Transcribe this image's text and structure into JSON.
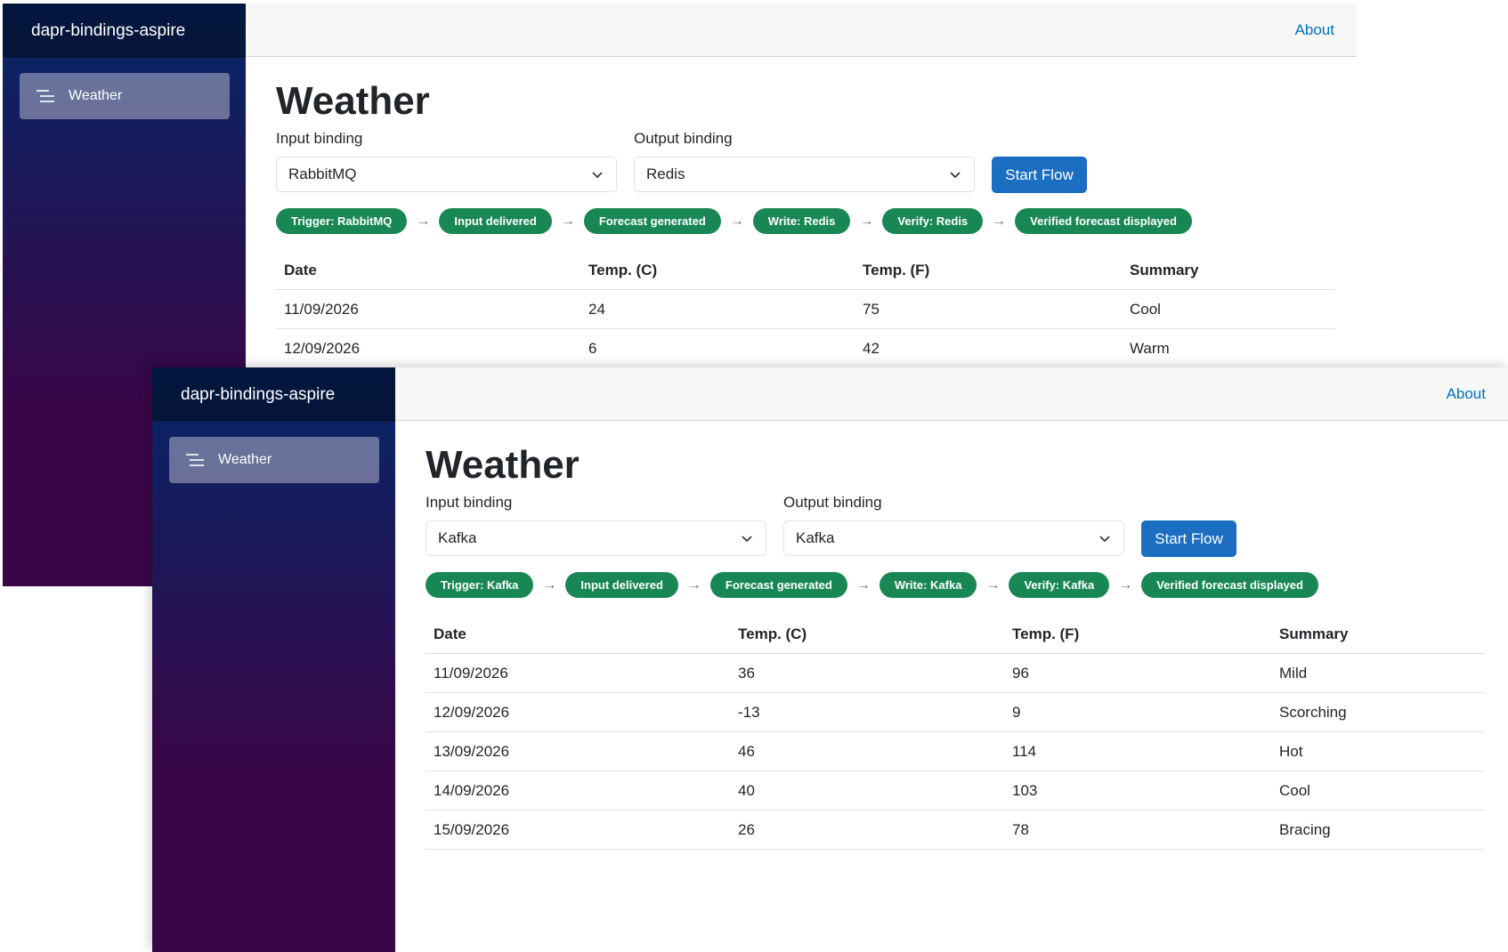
{
  "windows": [
    {
      "brand": "dapr-bindings-aspire",
      "nav_item": "Weather",
      "about": "About",
      "title": "Weather",
      "input_label": "Input binding",
      "input_value": "RabbitMQ",
      "output_label": "Output binding",
      "output_value": "Redis",
      "start_button": "Start Flow",
      "steps": [
        "Trigger: RabbitMQ",
        "Input delivered",
        "Forecast generated",
        "Write: Redis",
        "Verify: Redis",
        "Verified forecast displayed"
      ],
      "arrow": "→",
      "columns": [
        "Date",
        "Temp. (C)",
        "Temp. (F)",
        "Summary"
      ],
      "rows": [
        [
          "11/09/2026",
          "24",
          "75",
          "Cool"
        ],
        [
          "12/09/2026",
          "6",
          "42",
          "Warm"
        ]
      ]
    },
    {
      "brand": "dapr-bindings-aspire",
      "nav_item": "Weather",
      "about": "About",
      "title": "Weather",
      "input_label": "Input binding",
      "input_value": "Kafka",
      "output_label": "Output binding",
      "output_value": "Kafka",
      "start_button": "Start Flow",
      "steps": [
        "Trigger: Kafka",
        "Input delivered",
        "Forecast generated",
        "Write: Kafka",
        "Verify: Kafka",
        "Verified forecast displayed"
      ],
      "arrow": "→",
      "columns": [
        "Date",
        "Temp. (C)",
        "Temp. (F)",
        "Summary"
      ],
      "rows": [
        [
          "11/09/2026",
          "36",
          "96",
          "Mild"
        ],
        [
          "12/09/2026",
          "-13",
          "9",
          "Scorching"
        ],
        [
          "13/09/2026",
          "46",
          "114",
          "Hot"
        ],
        [
          "14/09/2026",
          "40",
          "103",
          "Cool"
        ],
        [
          "15/09/2026",
          "26",
          "78",
          "Bracing"
        ]
      ]
    }
  ],
  "colors": {
    "sidebar_top": "#052767",
    "sidebar_bottom": "#3a0647",
    "primary_button": "#1b6ec2",
    "step_green": "#198754",
    "link": "#0071c1"
  },
  "icons": {
    "nav": "menu-lines-icon",
    "select": "chevron-down-icon"
  }
}
